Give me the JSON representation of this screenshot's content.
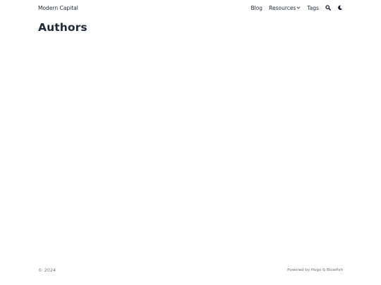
{
  "header": {
    "site_title": "Modern Capital",
    "nav": {
      "blog": "Blog",
      "resources": "Resources",
      "tags": "Tags"
    },
    "icons": {
      "search": "search-icon",
      "theme": "moon-icon",
      "dropdown": "chevron-down-icon"
    }
  },
  "main": {
    "title": "Authors"
  },
  "footer": {
    "copyright": "© 2024",
    "powered_prefix": "Powered by",
    "hugo": "Hugo",
    "ampersand": "&",
    "blowfish": "Blowfish"
  },
  "colors": {
    "background": "#ffffff",
    "text": "#1f2937",
    "muted": "#6b7280"
  }
}
